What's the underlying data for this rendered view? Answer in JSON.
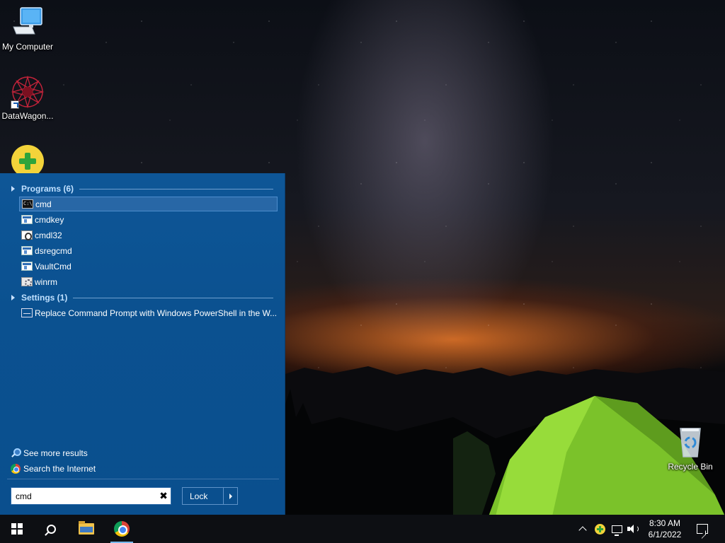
{
  "desktop": {
    "icons": [
      {
        "label": "My Computer",
        "icon": "computer-icon"
      },
      {
        "label": "DataWagon...",
        "icon": "datawagon-icon"
      },
      {
        "label": "",
        "icon": "add-app-icon"
      },
      {
        "label": "Recycle Bin",
        "icon": "recycle-bin-icon"
      }
    ]
  },
  "start_menu": {
    "programs_header": "Programs (6)",
    "programs": [
      {
        "label": "cmd",
        "icon": "console-icon",
        "selected": true
      },
      {
        "label": "cmdkey",
        "icon": "window-icon"
      },
      {
        "label": "cmdl32",
        "icon": "dll-icon"
      },
      {
        "label": "dsregcmd",
        "icon": "window-icon"
      },
      {
        "label": "VaultCmd",
        "icon": "window-icon"
      },
      {
        "label": "winrm",
        "icon": "gear-icon"
      }
    ],
    "settings_header": "Settings (1)",
    "settings": [
      {
        "label": "Replace Command Prompt with Windows PowerShell in the W...",
        "icon": "settings-icon"
      }
    ],
    "see_more_results": "See more results",
    "search_internet": "Search the Internet",
    "search": {
      "value": "cmd",
      "clear_glyph": "✖"
    },
    "lock_button": "Lock",
    "glyphs": {
      "console": "C:\\"
    }
  },
  "taskbar": {
    "items": [
      "start-button",
      "search-button",
      "file-explorer",
      "chrome"
    ],
    "active": "chrome",
    "clock": {
      "time": "8:30 AM",
      "date": "6/1/2022"
    }
  }
}
